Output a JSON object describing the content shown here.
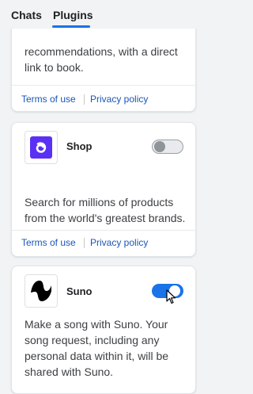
{
  "tabs": [
    {
      "label": "Chats",
      "active": false
    },
    {
      "label": "Plugins",
      "active": true
    }
  ],
  "plugins": [
    {
      "name": "",
      "description": "recommendations, with a direct link to book.",
      "terms_label": "Terms of use",
      "privacy_label": "Privacy policy"
    },
    {
      "name": "Shop",
      "description": "Search for millions of products from the world's greatest brands.",
      "enabled": false,
      "icon": "shop-logo-icon",
      "terms_label": "Terms of use",
      "privacy_label": "Privacy policy"
    },
    {
      "name": "Suno",
      "description": "Make a song with Suno. Your song request, including any personal data within it, will be shared with Suno.",
      "enabled": true,
      "icon": "suno-logo-icon"
    }
  ],
  "colors": {
    "accent": "#1a73e8",
    "link": "#1a56b8",
    "shop_brand": "#5a31f4"
  }
}
